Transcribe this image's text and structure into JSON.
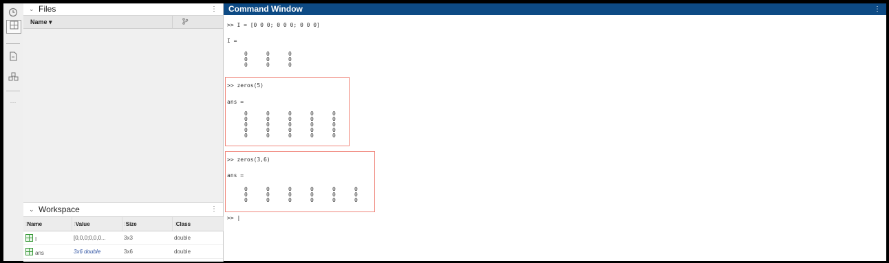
{
  "sidebar": {
    "icons": [
      "history-icon",
      "workspace-grid-icon",
      "editor-file-icon",
      "addons-icon",
      "more-icon"
    ],
    "more_label": "···"
  },
  "files_panel": {
    "title": "Files",
    "column_name": "Name ▾",
    "git_icon": "git-branch-icon"
  },
  "workspace": {
    "title": "Workspace",
    "columns": [
      "Name",
      "Value",
      "Size",
      "Class"
    ],
    "rows": [
      {
        "name": "I",
        "value": "[0,0,0;0,0,0...",
        "size": "3x3",
        "class": "double"
      },
      {
        "name": "ans",
        "value": "3x6 double",
        "size": "3x6",
        "class": "double"
      }
    ]
  },
  "command_window": {
    "title": "Command Window",
    "lines": {
      "cmd1": ">> I = [0 0 0; 0 0 0; 0 0 0]",
      "res1": "I =",
      "cmd2": ">> zeros(5)",
      "res2": "ans =",
      "cmd3": ">> zeros(3,6)",
      "res3": "ans =",
      "prompt": ">> |"
    },
    "matrices": {
      "m1": [
        [
          "0",
          "0",
          "0"
        ],
        [
          "0",
          "0",
          "0"
        ],
        [
          "0",
          "0",
          "0"
        ]
      ],
      "m2": [
        [
          "0",
          "0",
          "0",
          "0",
          "0"
        ],
        [
          "0",
          "0",
          "0",
          "0",
          "0"
        ],
        [
          "0",
          "0",
          "0",
          "0",
          "0"
        ],
        [
          "0",
          "0",
          "0",
          "0",
          "0"
        ],
        [
          "0",
          "0",
          "0",
          "0",
          "0"
        ]
      ],
      "m3": [
        [
          "0",
          "0",
          "0",
          "0",
          "0",
          "0"
        ],
        [
          "0",
          "0",
          "0",
          "0",
          "0",
          "0"
        ],
        [
          "0",
          "0",
          "0",
          "0",
          "0",
          "0"
        ]
      ]
    },
    "highlight_color": "#f0867b"
  }
}
